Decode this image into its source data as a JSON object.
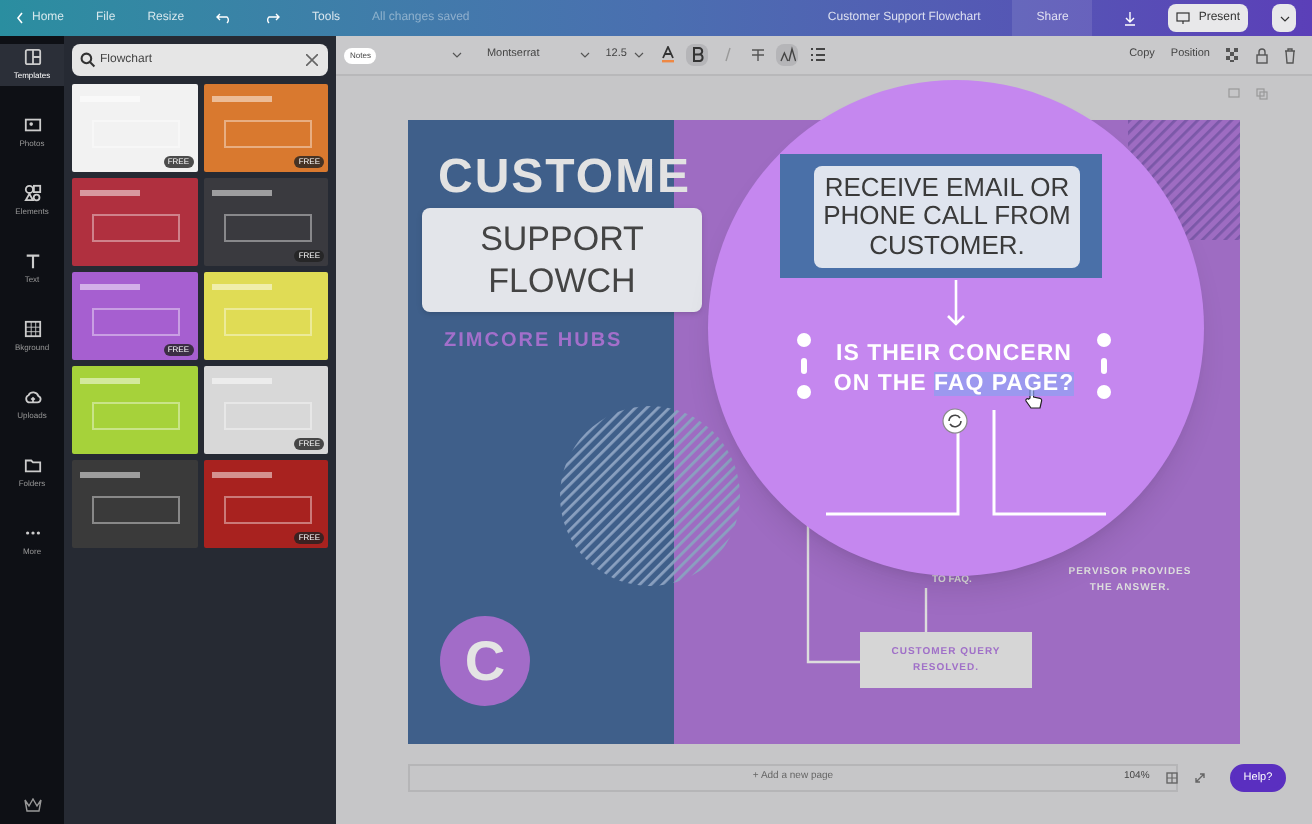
{
  "topbar": {
    "home": "Home",
    "menu": [
      "File",
      "Resize"
    ],
    "tools": "Tools",
    "save_status": "All changes saved",
    "doc_title": "Customer Support Flowchart",
    "share": "Share",
    "present": "Present"
  },
  "toolbar": {
    "notes": "Notes",
    "font": "Montserrat",
    "size": "12.5",
    "format": [
      {
        "kind": "color",
        "active": false
      },
      {
        "kind": "bold",
        "active": true
      },
      {
        "kind": "italic",
        "active": false
      },
      {
        "kind": "strike",
        "active": false
      },
      {
        "kind": "case",
        "active": true
      },
      {
        "kind": "list",
        "active": false
      }
    ],
    "copy": "Copy",
    "position": "Position"
  },
  "rail": [
    {
      "label": "Templates",
      "selected": true
    },
    {
      "label": "Photos",
      "selected": false
    },
    {
      "label": "Elements",
      "selected": false
    },
    {
      "label": "Text",
      "selected": false
    },
    {
      "label": "Bkground",
      "selected": false
    },
    {
      "label": "Uploads",
      "selected": false
    },
    {
      "label": "Folders",
      "selected": false
    },
    {
      "label": "More",
      "selected": false
    }
  ],
  "search": {
    "value": "Flowchart"
  },
  "templates": [
    {
      "color": "#f2f2f2",
      "free": "FREE"
    },
    {
      "color": "#d9792f",
      "free": "FREE"
    },
    {
      "color": "#b0303f"
    },
    {
      "color": "#3a3a3f",
      "free": "FREE"
    },
    {
      "color": "#a65fd0",
      "free": "FREE"
    },
    {
      "color": "#e0dc55"
    },
    {
      "color": "#a6d23a"
    },
    {
      "color": "#d8d8d8",
      "free": "FREE"
    },
    {
      "color": "#3a3a3a"
    },
    {
      "color": "#a8221f",
      "free": "FREE"
    }
  ],
  "design": {
    "title_top": "CUSTOME",
    "title_box": "SUPPORT FLOWCH",
    "subtitle": "ZIMCORE HUBS",
    "logo": "C",
    "step_faq": "TO FAQ.",
    "step_supervisor": "PERVISOR PROVIDES THE ANSWER.",
    "resolved": "CUSTOMER QUERY RESOLVED."
  },
  "magnifier": {
    "step_receive": "RECEIVE EMAIL OR PHONE CALL FROM CUSTOMER.",
    "question": [
      {
        "text": "IS THEIR CONCERN ON THE ",
        "highlighted": false
      },
      {
        "text": "FAQ PAGE?",
        "highlighted": true
      }
    ]
  },
  "bottom": {
    "add_page": "+ Add a new page",
    "zoom": "104%",
    "help": "Help?"
  }
}
